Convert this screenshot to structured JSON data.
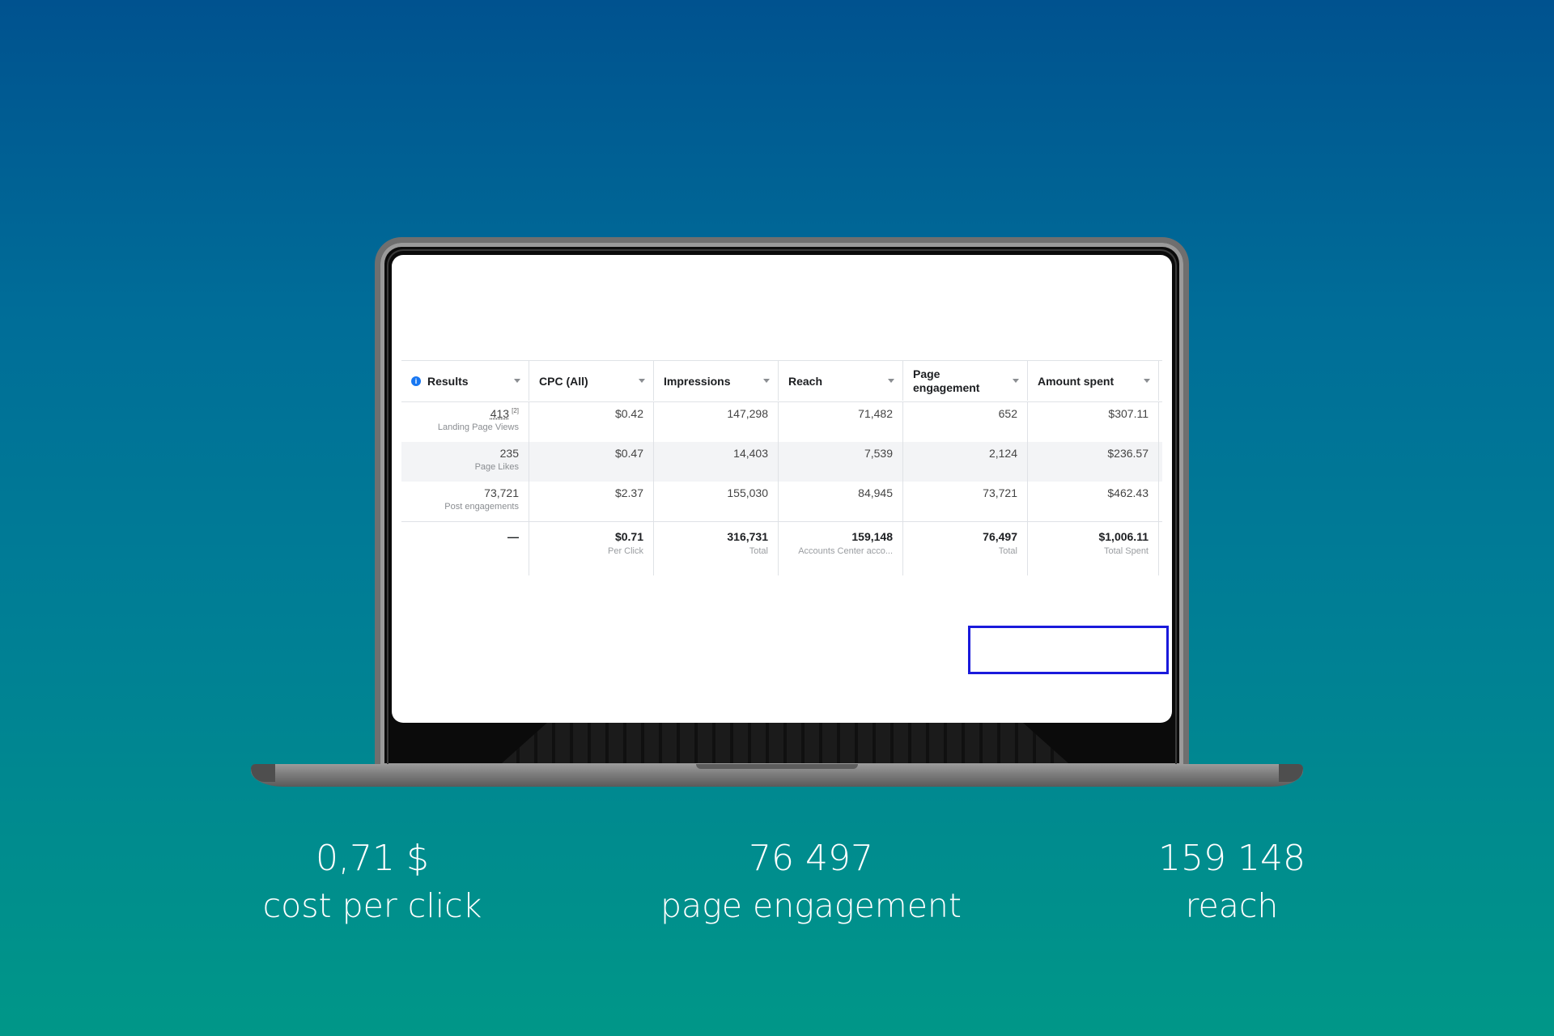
{
  "table": {
    "headers": [
      "Results",
      "CPC (All)",
      "Impressions",
      "Reach",
      "Page engagement",
      "Amount spent"
    ],
    "info_icon": "i",
    "rows": [
      {
        "results": "413",
        "results_sup": "[2]",
        "results_sub": "Landing Page Views",
        "cpc": "$0.42",
        "impressions": "147,298",
        "reach": "71,482",
        "engagement": "652",
        "spent": "$307.11"
      },
      {
        "results": "235",
        "results_sub": "Page Likes",
        "cpc": "$0.47",
        "impressions": "14,403",
        "reach": "7,539",
        "engagement": "2,124",
        "spent": "$236.57"
      },
      {
        "results": "73,721",
        "results_sub": "Post engagements",
        "cpc": "$2.37",
        "impressions": "155,030",
        "reach": "84,945",
        "engagement": "73,721",
        "spent": "$462.43"
      }
    ],
    "totals": {
      "results": "—",
      "cpc": "$0.71",
      "cpc_sub": "Per Click",
      "impressions": "316,731",
      "impressions_sub": "Total",
      "reach": "159,148",
      "reach_sub": "Accounts Center acco...",
      "engagement": "76,497",
      "engagement_sub": "Total",
      "spent": "$1,006.11",
      "spent_sub": "Total Spent"
    }
  },
  "stats": [
    {
      "value": "0,71 $",
      "label": "cost per click"
    },
    {
      "value": "76 497",
      "label": "page engagement"
    },
    {
      "value": "159 148",
      "label": "reach"
    }
  ],
  "colors": {
    "highlight": "#1a1adb",
    "info_icon": "#1877f2",
    "background_top": "#00528f",
    "background_bottom": "#009788"
  }
}
